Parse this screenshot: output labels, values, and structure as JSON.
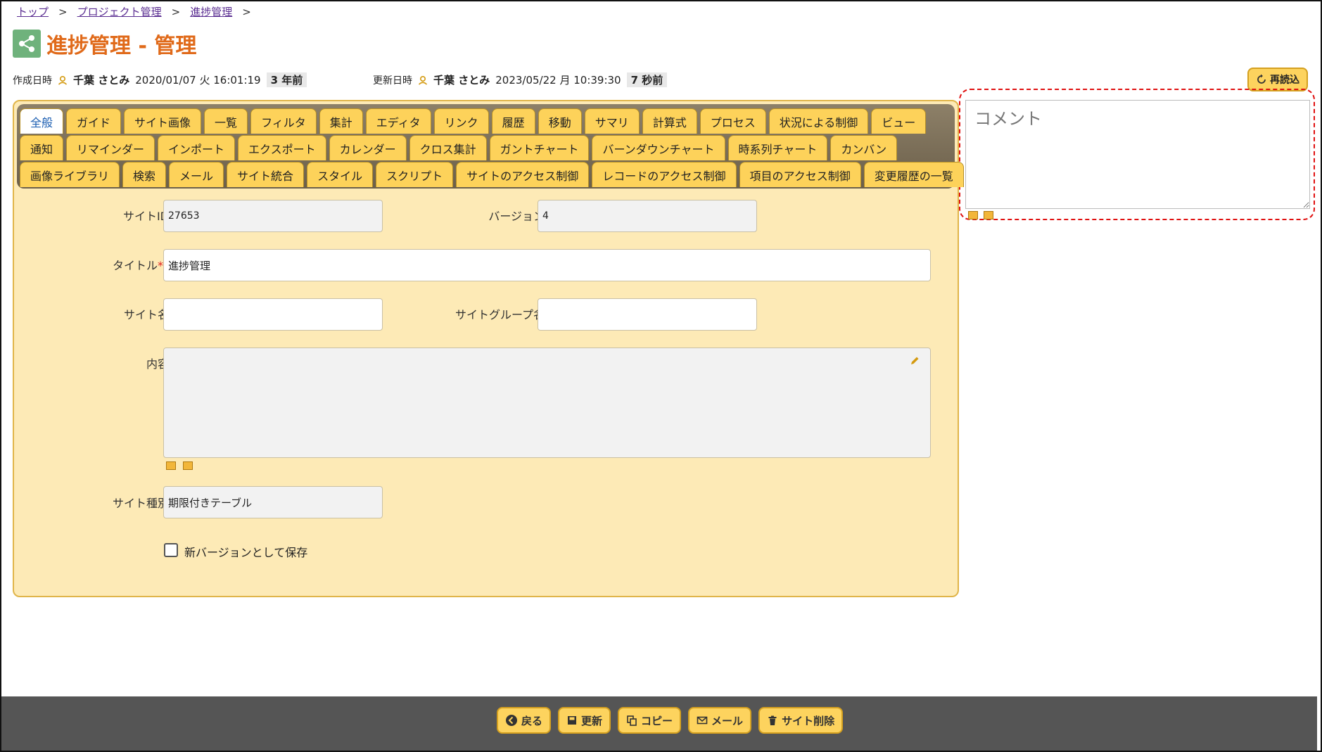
{
  "breadcrumb": {
    "items": [
      "トップ",
      "プロジェクト管理",
      "進捗管理"
    ],
    "separator": ">"
  },
  "page": {
    "title": "進捗管理 - 管理"
  },
  "meta": {
    "created_label": "作成日時",
    "created_user": "千葉 さとみ",
    "created_datetime": "2020/01/07 火 16:01:19",
    "created_ago": "3 年前",
    "updated_label": "更新日時",
    "updated_user": "千葉 さとみ",
    "updated_datetime": "2023/05/22 月 10:39:30",
    "updated_ago": "7 秒前"
  },
  "reload_label": "再読込",
  "comment": {
    "placeholder": "コメント"
  },
  "tabs": {
    "row1": [
      "全般",
      "ガイド",
      "サイト画像",
      "一覧",
      "フィルタ",
      "集計",
      "エディタ",
      "リンク",
      "履歴",
      "移動",
      "サマリ",
      "計算式",
      "プロセス",
      "状況による制御",
      "ビュー"
    ],
    "row2": [
      "通知",
      "リマインダー",
      "インポート",
      "エクスポート",
      "カレンダー",
      "クロス集計",
      "ガントチャート",
      "バーンダウンチャート",
      "時系列チャート",
      "カンバン"
    ],
    "row3": [
      "画像ライブラリ",
      "検索",
      "メール",
      "サイト統合",
      "スタイル",
      "スクリプト",
      "サイトのアクセス制御",
      "レコードのアクセス制御",
      "項目のアクセス制御",
      "変更履歴の一覧"
    ],
    "active": "全般"
  },
  "form": {
    "site_id_label": "サイトID",
    "site_id_value": "27653",
    "version_label": "バージョン",
    "version_value": "4",
    "title_label": "タイトル",
    "title_required": "*",
    "title_value": "進捗管理",
    "site_name_label": "サイト名",
    "site_name_value": "",
    "site_group_label": "サイトグループ名",
    "site_group_value": "",
    "content_label": "内容",
    "site_type_label": "サイト種別",
    "site_type_value": "期限付きテーブル",
    "new_version_label": "新バージョンとして保存"
  },
  "footer": {
    "back": "戻る",
    "update": "更新",
    "copy": "コピー",
    "mail": "メール",
    "delete": "サイト削除"
  },
  "colors": {
    "accent": "#e06a1a",
    "tab": "#fdd25a",
    "panel": "#fdeab6",
    "highlight": "#e01010"
  }
}
